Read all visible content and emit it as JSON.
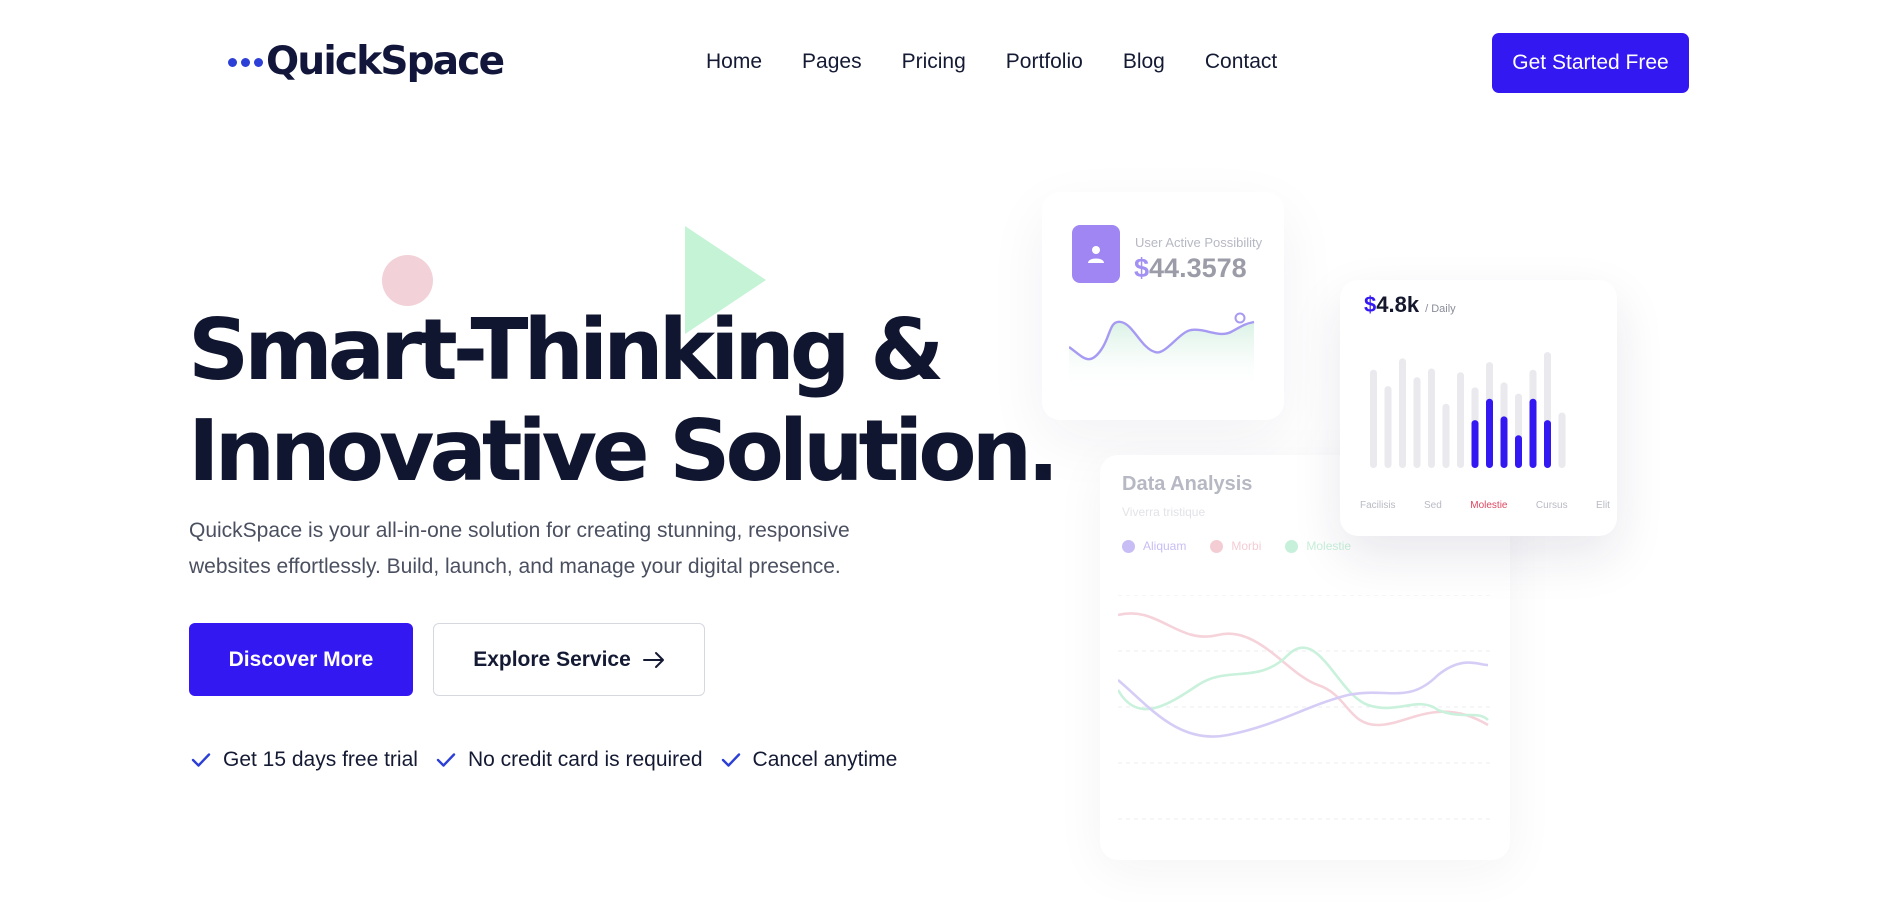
{
  "brand": {
    "name": "QuickSpace"
  },
  "nav": {
    "items": [
      "Home",
      "Pages",
      "Pricing",
      "Portfolio",
      "Blog",
      "Contact"
    ]
  },
  "header": {
    "cta_label": "Get Started Free"
  },
  "hero": {
    "title_line1": "Smart-Thinking &",
    "title_line2": "Innovative Solution.",
    "description_line1": "QuickSpace is your all-in-one solution for creating stunning, responsive",
    "description_line2": "websites effortlessly. Build, launch, and manage your digital presence.",
    "primary_button": "Discover More",
    "secondary_button": "Explore Service",
    "checks": [
      "Get 15 days free trial",
      "No credit card is required",
      "Cancel anytime"
    ]
  },
  "colors": {
    "accent": "#3418f2",
    "heading": "#10162f",
    "check": "#2c3fd6",
    "deco_circle": "#f2d1d8",
    "deco_triangle": "#c4f3d6"
  },
  "cards": {
    "user": {
      "label": "User Active Possibility",
      "currency": "$",
      "value": "44.3578",
      "sparkline": [
        0.55,
        0.35,
        0.05,
        0.85,
        0.7,
        0.55,
        0.75,
        0.2,
        0.25,
        0.65,
        0.35,
        0.1,
        0.15
      ]
    },
    "analysis": {
      "title": "Data Analysis",
      "subtitle": "Viverra tristique",
      "legend": [
        {
          "label": "Aliquam",
          "color": "#c9bdf5"
        },
        {
          "label": "Morbi",
          "color": "#f4cdd4"
        },
        {
          "label": "Molestie",
          "color": "#c7f0da"
        }
      ]
    },
    "daily": {
      "currency": "$",
      "value": "4.8k",
      "unit": "/ Daily",
      "x_labels": [
        {
          "text": "Facilisis",
          "color": "#b9bac4"
        },
        {
          "text": "Sed",
          "color": "#b9bac4"
        },
        {
          "text": "Molestie",
          "color": "#e0475f"
        },
        {
          "text": "Cursus",
          "color": "#b9bac4"
        },
        {
          "text": "Elit",
          "color": "#b9bac4"
        }
      ]
    }
  },
  "chart_data": {
    "type": "bar",
    "series": [
      {
        "values": [
          0.78,
          0.65,
          0.87,
          0.72,
          0.79,
          0.51,
          0.76,
          0.64,
          0.84,
          0.68,
          0.59,
          0.78,
          0.92,
          0.44
        ]
      },
      {
        "values": [
          0,
          0,
          0,
          0,
          0,
          0,
          0,
          0.38,
          0.55,
          0.41,
          0.26,
          0.55,
          0.38,
          0
        ]
      }
    ]
  }
}
